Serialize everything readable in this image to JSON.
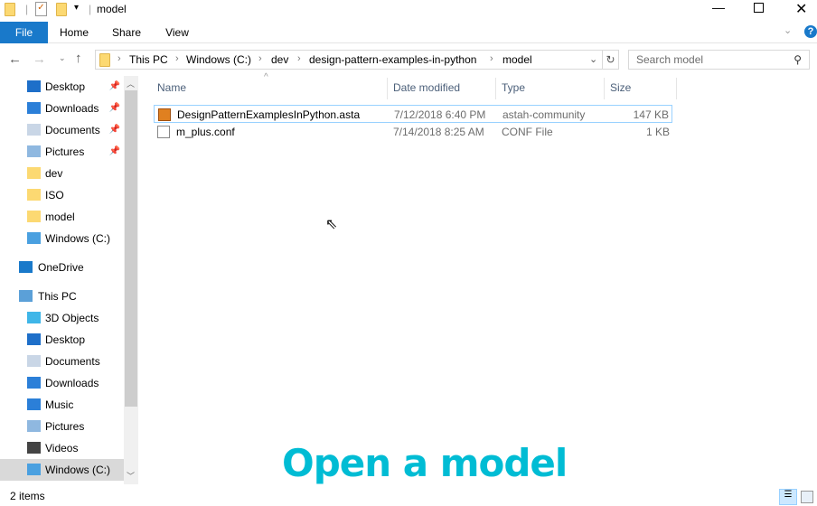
{
  "window": {
    "title": "model"
  },
  "ribbon": {
    "tabs": [
      "File",
      "Home",
      "Share",
      "View"
    ]
  },
  "address": {
    "crumbs": [
      "This PC",
      "Windows (C:)",
      "dev",
      "design-pattern-examples-in-python",
      "model"
    ]
  },
  "search": {
    "placeholder": "Search model"
  },
  "sidebar": {
    "items": [
      {
        "label": "Desktop",
        "icon": "desktop-icon",
        "pinned": true
      },
      {
        "label": "Downloads",
        "icon": "download-icon",
        "pinned": true
      },
      {
        "label": "Documents",
        "icon": "documents-icon",
        "pinned": true
      },
      {
        "label": "Pictures",
        "icon": "pictures-icon",
        "pinned": true
      },
      {
        "label": "dev",
        "icon": "folder-icon"
      },
      {
        "label": "ISO",
        "icon": "folder-icon"
      },
      {
        "label": "model",
        "icon": "folder-icon"
      },
      {
        "label": "Windows (C:)",
        "icon": "drive-icon"
      },
      {
        "label": "OneDrive",
        "icon": "cloud-icon"
      },
      {
        "label": "This PC",
        "icon": "computer-icon"
      },
      {
        "label": "3D Objects",
        "icon": "cube-icon"
      },
      {
        "label": "Desktop",
        "icon": "desktop-icon"
      },
      {
        "label": "Documents",
        "icon": "documents-icon"
      },
      {
        "label": "Downloads",
        "icon": "download-icon"
      },
      {
        "label": "Music",
        "icon": "music-icon"
      },
      {
        "label": "Pictures",
        "icon": "pictures-icon"
      },
      {
        "label": "Videos",
        "icon": "video-icon"
      },
      {
        "label": "Windows (C:)",
        "icon": "drive-icon",
        "selected": true
      }
    ]
  },
  "columns": [
    "Name",
    "Date modified",
    "Type",
    "Size"
  ],
  "files": [
    {
      "name": "DesignPatternExamplesInPython.asta",
      "date": "7/12/2018 6:40 PM",
      "type": "astah-community",
      "size": "147 KB"
    },
    {
      "name": "m_plus.conf",
      "date": "7/14/2018 8:25 AM",
      "type": "CONF File",
      "size": "1 KB"
    }
  ],
  "status": {
    "items": "2 items"
  },
  "caption": "Open a model",
  "colors": {
    "accent": "#1979ca",
    "caption": "#00bcd4"
  }
}
